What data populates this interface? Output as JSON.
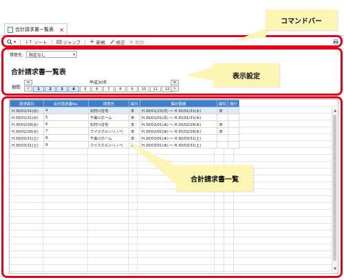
{
  "tab": {
    "title": "合計請求書一覧表",
    "close": "×"
  },
  "toolbar": {
    "sort": "ソート",
    "jump": "ジャンプ",
    "new": "新規",
    "edit": "修正",
    "delete": "削除"
  },
  "settings": {
    "filter_label": "得意先:",
    "filter_value": "指定なし",
    "page_title": "合計請求書一覧表",
    "period_label": "期間:",
    "year": "平成30年",
    "months": [
      "1",
      "2",
      "3",
      "4",
      "5",
      "6",
      "7",
      "8",
      "9",
      "10",
      "11",
      "12"
    ],
    "active_months": [
      1,
      2,
      3,
      4
    ]
  },
  "table": {
    "columns": [
      "請求締日",
      "合計請求書No.",
      "得意先",
      "締日",
      "集計期間",
      "締切",
      "発行"
    ],
    "rows": [
      [
        "H.30/01/31(水)",
        "4",
        "石狩川住宅",
        "末",
        "H.30/01/23(月) ～ H.30/01/31(水)",
        "済",
        ""
      ],
      [
        "H.30/01/31(水)",
        "5",
        "千曲川ホーム",
        "末",
        "H.30/01/01(月) ～ H.30/01/31(水)",
        "",
        ""
      ],
      [
        "H.30/02/28(水)",
        "6",
        "石狩川住宅",
        "末",
        "H.30/02/01(木) ～ H.30/02/28(水)",
        "済",
        ""
      ],
      [
        "H.30/02/28(水)",
        "7",
        "ウイスホルンリノベ",
        "末",
        "H.30/02/02(木) ～ H.30/02/28(水)",
        "済",
        ""
      ],
      [
        "H.30/03/31(土)",
        "8",
        "千曲川ホーム",
        "末",
        "H.30/03/01(木) ～ H.30/03/31(土)",
        "",
        ""
      ],
      [
        "H.30/03/31(土)",
        "9",
        "ウイスホルンリノベ",
        "末",
        "H.30/03/01(木) ～ H.30/03/31(土)",
        "",
        ""
      ]
    ]
  },
  "callouts": {
    "command_bar": "コマンドバー",
    "display_settings": "表示設定",
    "invoice_list": "合計請求書一覧"
  },
  "colors": {
    "highlight": "#e3001b",
    "callout": "#fdf5b4",
    "header": "#3e7fc8"
  }
}
